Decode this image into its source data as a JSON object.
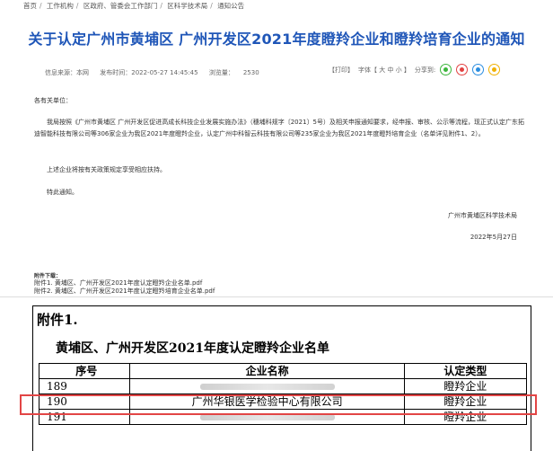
{
  "breadcrumb": [
    "首页",
    "工作机构",
    "区政府、管委会工作部门",
    "区科学技术局",
    "通知公告"
  ],
  "article": {
    "title": "关于认定广州市黄埔区 广州开发区2021年度瞪羚企业和瞪羚培育企业的通知",
    "source_label": "信息来源：本网",
    "publish_label": "发布时间：2022-05-27 14:45:45",
    "views_label": "浏览量：",
    "views_count": "2530",
    "print_label": "【打印】",
    "font_label": "字体【 大  中  小 】",
    "share_label": "分享到:",
    "salutation": "各有关单位：",
    "paragraph1": "我局按照《广州市黄埔区 广州开发区促进高成长科技企业发展实施办法》（穗埔科规字〔2021〕5号）及相关申报通知要求，经申报、审核、公示等流程，现正式认定广东拓迪智能科技有限公司等306家企业为我区2021年度瞪羚企业，认定广州中科智云科技有限公司等235家企业为我区2021年度瞪羚培育企业（名单详见附件1、2）。",
    "paragraph2": "上述企业将按有关政策规定享受相应扶持。",
    "paragraph3": "特此通知。",
    "organization": "广州市黄埔区科学技术局",
    "date": "2022年5月27日",
    "attachments_title": "附件下载：",
    "attachments": [
      "附件1. 黄埔区、广州开发区2021年度认定瞪羚企业名单.pdf",
      "附件2. 黄埔区、广州开发区2021年度认定瞪羚培育企业名单.pdf"
    ]
  },
  "document": {
    "attachment_label": "附件1.",
    "list_title": "黄埔区、广州开发区2021年度认定瞪羚企业名单",
    "headers": [
      "序号",
      "企业名称",
      "认定类型"
    ],
    "rows": [
      {
        "no": "189",
        "name": "",
        "type": "瞪羚企业"
      },
      {
        "no": "190",
        "name": "广州华银医学检验中心有限公司",
        "type": "瞪羚企业"
      },
      {
        "no": "191",
        "name": "",
        "type": "瞪羚企业"
      }
    ]
  },
  "colors": {
    "title": "#1f56b8",
    "highlight": "#e24545"
  }
}
